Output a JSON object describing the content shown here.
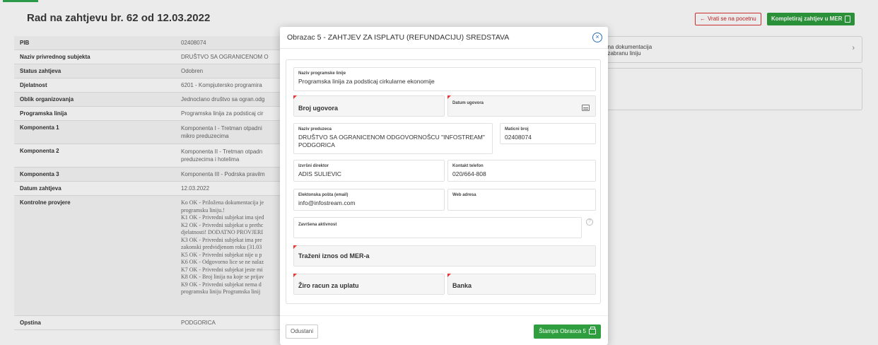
{
  "page": {
    "title": "Rad na zahtjevu br. 62 od 12.03.2022",
    "back_button": "Vrati se na pocetnu",
    "complete_button": "Kompletiraj zahtjev u MER"
  },
  "details": {
    "rows": [
      {
        "label": "PIB",
        "value": "02408074"
      },
      {
        "label": "Naziv privrednog subjekta",
        "value": "DRUŠTVO SA OGRANICENOM O"
      },
      {
        "label": "Status zahtjeva",
        "value": "Odobren"
      },
      {
        "label": "Djelatnost",
        "value": "6201 - Kompjutersko programira"
      },
      {
        "label": "Oblik organizovanja",
        "value": "Jednoclano društvo sa ogran.odg"
      },
      {
        "label": "Programska linija",
        "value": "Programska linija za podsticaj cir"
      },
      {
        "label": "Komponenta 1",
        "value": "Komponenta I - Tretman otpadni\nmikro preduzecima"
      },
      {
        "label": "Komponenta 2",
        "value": "Komponenta II - Tretman otpadn\npreduzecima i hotelima"
      },
      {
        "label": "Komponenta 3",
        "value": "Komponenta III - Podrska pravilm"
      },
      {
        "label": "Datum zahtjeva",
        "value": "12.03.2022"
      },
      {
        "label": "Kontrolne provjere",
        "value": ""
      }
    ],
    "checks": [
      "Ko OK - Priložena dokumentacija je",
      "programsku liniju.!",
      "K1 OK - Privredni subjekat ima sjed",
      "K2 OK - Privredni subjekat u prethc",
      "djelatnosti! DODATNO PROVJERI",
      "K3 OK - Privredni subjekat ima pre",
      "zakonski predvidjenom roku (31.03",
      "K5 OK - Privredni subjekat nije u p",
      "K6 OK - Odgovorno lice se ne nalaz",
      "K7 OK - Privredni subjekat jeste mi",
      "K8 OK - Broj linija na koje se prijav",
      "K9 OK - Privredni subjekat nema d",
      "programsku liniju Programska linij"
    ],
    "last_row": {
      "label": "Opstina",
      "value": "PODGORICA"
    }
  },
  "right_panel": {
    "line1": "ezna dokumentacija",
    "line2": "a izabranu liniju"
  },
  "modal": {
    "title": "Obrazac 5 - ZAHTJEV ZA ISPLATU (REFUNDACIJU) SREDSTAVA",
    "fields": {
      "program_line_label": "Naziv programske linije",
      "program_line_value": "Programska linija za podsticaj cirkularne ekonomije",
      "contract_number": "Broj ugovora",
      "contract_date_label": "Datum ugovora",
      "company_name_label": "Naziv preduzeca",
      "company_name_value": "DRUŠTVO SA OGRANICENOM ODGOVORNOŠCU \"INFOSTREAM\" PODGORICA",
      "reg_number_label": "Maticni broj",
      "reg_number_value": "02408074",
      "director_label": "Izvršni direktor",
      "director_value": "ADIS SULIEVIC",
      "phone_label": "Kontakt telefon",
      "phone_value": "020/664-808",
      "email_label": "Elektonska pošta (email)",
      "email_value": "info@infostream.com",
      "web_label": "Web adresa",
      "web_value": "",
      "activity_label": "Završena aktivnost",
      "amount_label": "Traženi iznos od MER-a",
      "account_label": "Žiro racun za uplatu",
      "bank_label": "Banka"
    },
    "cancel_button": "Odustani",
    "print_button": "Štampa Obrasca 5"
  },
  "colors": {
    "accent_green": "#2e9e3e",
    "danger_red": "#d33333",
    "close_blue": "#2a6fb5"
  }
}
